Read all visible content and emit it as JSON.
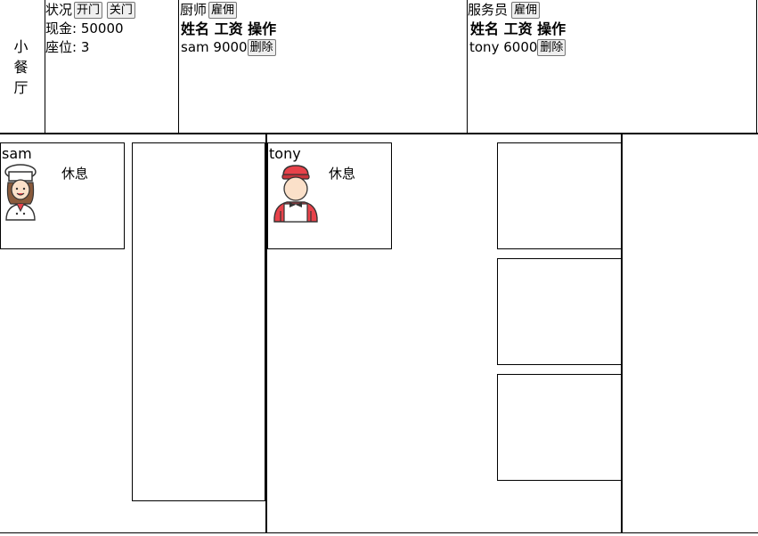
{
  "title": "小\n餐\n厅",
  "status_panel": {
    "status_label": "状况",
    "open_button": "开门",
    "close_button": "关门",
    "cash_line": "现金: 50000",
    "seats_line": "座位: 3"
  },
  "chef_panel": {
    "label": "厨师",
    "hire_button": "雇佣",
    "header": "姓名 工资 操作",
    "rows": [
      {
        "name": "sam",
        "salary": "9000",
        "delete_button": "删除"
      }
    ]
  },
  "waiter_panel": {
    "label": "服务员",
    "hire_button": "雇佣",
    "header": "姓名 工资 操作",
    "rows": [
      {
        "name": "tony",
        "salary": "6000",
        "delete_button": "删除"
      }
    ]
  },
  "kitchen": {
    "chefs": [
      {
        "name": "sam",
        "status": "休息",
        "avatar_icon": "chef-woman-icon"
      }
    ]
  },
  "service": {
    "waiters": [
      {
        "name": "tony",
        "status": "休息",
        "avatar_icon": "waiter-man-icon"
      }
    ]
  },
  "colors": {
    "hat_red": "#e8424a",
    "skin": "#fbe0c9",
    "hair_brown": "#8a5a3b",
    "border": "#000000"
  }
}
